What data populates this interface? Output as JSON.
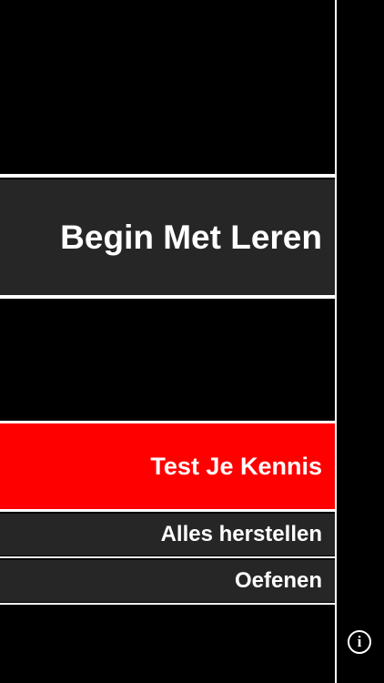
{
  "menu": {
    "begin_label": "Begin Met Leren",
    "test_label": "Test Je Kennis",
    "reset_label": "Alles herstellen",
    "practice_label": "Oefenen"
  },
  "info": {
    "icon_name": "info-icon",
    "glyph": "i"
  },
  "colors": {
    "background": "#000000",
    "button_dark": "#262626",
    "accent_red": "#ff0000",
    "text": "#ffffff"
  }
}
